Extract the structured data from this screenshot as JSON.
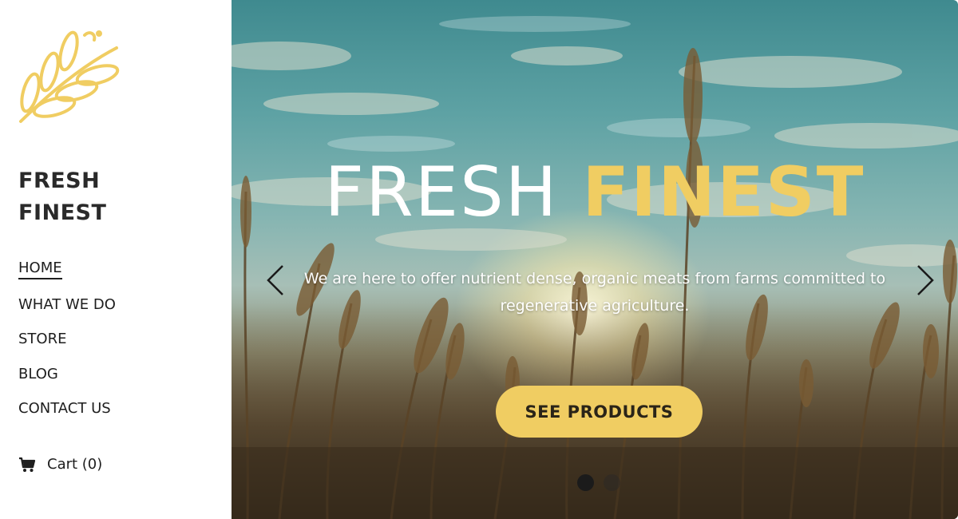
{
  "brand": {
    "line1": "FRESH",
    "line2": "FINEST",
    "logo_icon": "wheat-icon",
    "accent_color": "#f0cd62"
  },
  "nav": {
    "items": [
      {
        "label": "HOME",
        "active": true
      },
      {
        "label": "WHAT WE DO",
        "active": false
      },
      {
        "label": "STORE",
        "active": false
      },
      {
        "label": "BLOG",
        "active": false
      },
      {
        "label": "CONTACT US",
        "active": false
      }
    ]
  },
  "cart": {
    "label": "Cart (0)",
    "icon": "cart-icon"
  },
  "hero": {
    "title_part1": "FRESH",
    "title_part2": "FINEST",
    "subtitle": "We are here to offer nutrient dense, organic meats from farms committed to regenerative agriculture.",
    "cta_label": "SEE PRODUCTS",
    "prev_icon": "chevron-left-icon",
    "next_icon": "chevron-right-icon",
    "slides_total": 2,
    "active_slide": 1
  }
}
